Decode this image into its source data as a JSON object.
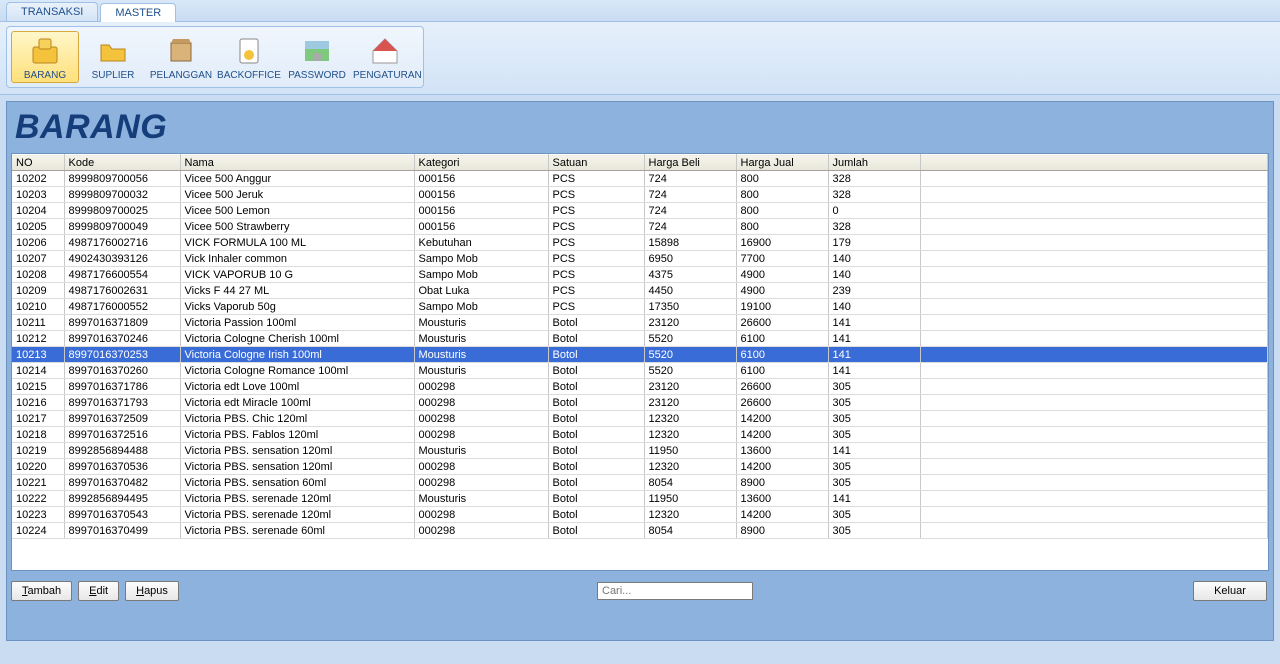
{
  "tabs": {
    "transaksi": "TRANSAKSI",
    "master": "MASTER",
    "active": "master"
  },
  "ribbon": {
    "barang": "BARANG",
    "suplier": "SUPLIER",
    "pelanggan": "PELANGGAN",
    "backoffice": "BACKOFFICE",
    "password": "PASSWORD",
    "pengaturan": "PENGATURAN",
    "active": "barang"
  },
  "title": "BARANG",
  "headers": {
    "no": "NO",
    "kode": "Kode",
    "nama": "Nama",
    "kategori": "Kategori",
    "satuan": "Satuan",
    "hb": "Harga Beli",
    "hj": "Harga Jual",
    "jml": "Jumlah"
  },
  "rows": [
    {
      "no": "10202",
      "kode": "8999809700056",
      "nama": "Vicee 500 Anggur",
      "kat": "000156",
      "sat": "PCS",
      "hb": "724",
      "hj": "800",
      "jml": "328"
    },
    {
      "no": "10203",
      "kode": "8999809700032",
      "nama": "Vicee 500 Jeruk",
      "kat": "000156",
      "sat": "PCS",
      "hb": "724",
      "hj": "800",
      "jml": "328"
    },
    {
      "no": "10204",
      "kode": "8999809700025",
      "nama": "Vicee 500 Lemon",
      "kat": "000156",
      "sat": "PCS",
      "hb": "724",
      "hj": "800",
      "jml": "0"
    },
    {
      "no": "10205",
      "kode": "8999809700049",
      "nama": "Vicee 500 Strawberry",
      "kat": "000156",
      "sat": "PCS",
      "hb": "724",
      "hj": "800",
      "jml": "328"
    },
    {
      "no": "10206",
      "kode": "4987176002716",
      "nama": "VICK FORMULA 100 ML",
      "kat": "Kebutuhan",
      "sat": "PCS",
      "hb": "15898",
      "hj": "16900",
      "jml": "179"
    },
    {
      "no": "10207",
      "kode": "4902430393126",
      "nama": "Vick Inhaler common",
      "kat": "Sampo Mob",
      "sat": "PCS",
      "hb": "6950",
      "hj": "7700",
      "jml": "140"
    },
    {
      "no": "10208",
      "kode": "4987176600554",
      "nama": "VICK VAPORUB 10 G",
      "kat": "Sampo Mob",
      "sat": "PCS",
      "hb": "4375",
      "hj": "4900",
      "jml": "140"
    },
    {
      "no": "10209",
      "kode": "4987176002631",
      "nama": "Vicks F 44 27 ML",
      "kat": "Obat Luka",
      "sat": "PCS",
      "hb": "4450",
      "hj": "4900",
      "jml": "239"
    },
    {
      "no": "10210",
      "kode": "4987176000552",
      "nama": "Vicks Vaporub 50g",
      "kat": "Sampo Mob",
      "sat": "PCS",
      "hb": "17350",
      "hj": "19100",
      "jml": "140"
    },
    {
      "no": "10211",
      "kode": "8997016371809",
      "nama": "Victoria  Passion 100ml",
      "kat": "Mousturis",
      "sat": "Botol",
      "hb": "23120",
      "hj": "26600",
      "jml": "141"
    },
    {
      "no": "10212",
      "kode": "8997016370246",
      "nama": "Victoria Cologne Cherish 100ml",
      "kat": "Mousturis",
      "sat": "Botol",
      "hb": "5520",
      "hj": "6100",
      "jml": "141"
    },
    {
      "no": "10213",
      "kode": "8997016370253",
      "nama": "Victoria Cologne Irish 100ml",
      "kat": "Mousturis",
      "sat": "Botol",
      "hb": "5520",
      "hj": "6100",
      "jml": "141",
      "selected": true
    },
    {
      "no": "10214",
      "kode": "8997016370260",
      "nama": "Victoria Cologne Romance 100ml",
      "kat": "Mousturis",
      "sat": "Botol",
      "hb": "5520",
      "hj": "6100",
      "jml": "141"
    },
    {
      "no": "10215",
      "kode": "8997016371786",
      "nama": "Victoria edt Love 100ml",
      "kat": "000298",
      "sat": "Botol",
      "hb": "23120",
      "hj": "26600",
      "jml": "305"
    },
    {
      "no": "10216",
      "kode": "8997016371793",
      "nama": "Victoria edt Miracle 100ml",
      "kat": "000298",
      "sat": "Botol",
      "hb": "23120",
      "hj": "26600",
      "jml": "305"
    },
    {
      "no": "10217",
      "kode": "8997016372509",
      "nama": "Victoria PBS. Chic 120ml",
      "kat": "000298",
      "sat": "Botol",
      "hb": "12320",
      "hj": "14200",
      "jml": "305"
    },
    {
      "no": "10218",
      "kode": "8997016372516",
      "nama": "Victoria PBS. Fablos 120ml",
      "kat": "000298",
      "sat": "Botol",
      "hb": "12320",
      "hj": "14200",
      "jml": "305"
    },
    {
      "no": "10219",
      "kode": "8992856894488",
      "nama": "Victoria PBS. sensation 120ml",
      "kat": "Mousturis",
      "sat": "Botol",
      "hb": "11950",
      "hj": "13600",
      "jml": "141"
    },
    {
      "no": "10220",
      "kode": "8997016370536",
      "nama": "Victoria PBS. sensation 120ml",
      "kat": "000298",
      "sat": "Botol",
      "hb": "12320",
      "hj": "14200",
      "jml": "305"
    },
    {
      "no": "10221",
      "kode": "8997016370482",
      "nama": "Victoria PBS. sensation 60ml",
      "kat": "000298",
      "sat": "Botol",
      "hb": "8054",
      "hj": "8900",
      "jml": "305"
    },
    {
      "no": "10222",
      "kode": "8992856894495",
      "nama": "Victoria PBS. serenade 120ml",
      "kat": "Mousturis",
      "sat": "Botol",
      "hb": "11950",
      "hj": "13600",
      "jml": "141"
    },
    {
      "no": "10223",
      "kode": "8997016370543",
      "nama": "Victoria PBS. serenade 120ml",
      "kat": "000298",
      "sat": "Botol",
      "hb": "12320",
      "hj": "14200",
      "jml": "305"
    },
    {
      "no": "10224",
      "kode": "8997016370499",
      "nama": "Victoria PBS. serenade 60ml",
      "kat": "000298",
      "sat": "Botol",
      "hb": "8054",
      "hj": "8900",
      "jml": "305"
    }
  ],
  "buttons": {
    "tambah": "ambah",
    "tambah_u": "T",
    "edit": "dit",
    "edit_u": "E",
    "hapus": "apus",
    "hapus_u": "H",
    "keluar": "Keluar"
  },
  "search_placeholder": "Cari..."
}
